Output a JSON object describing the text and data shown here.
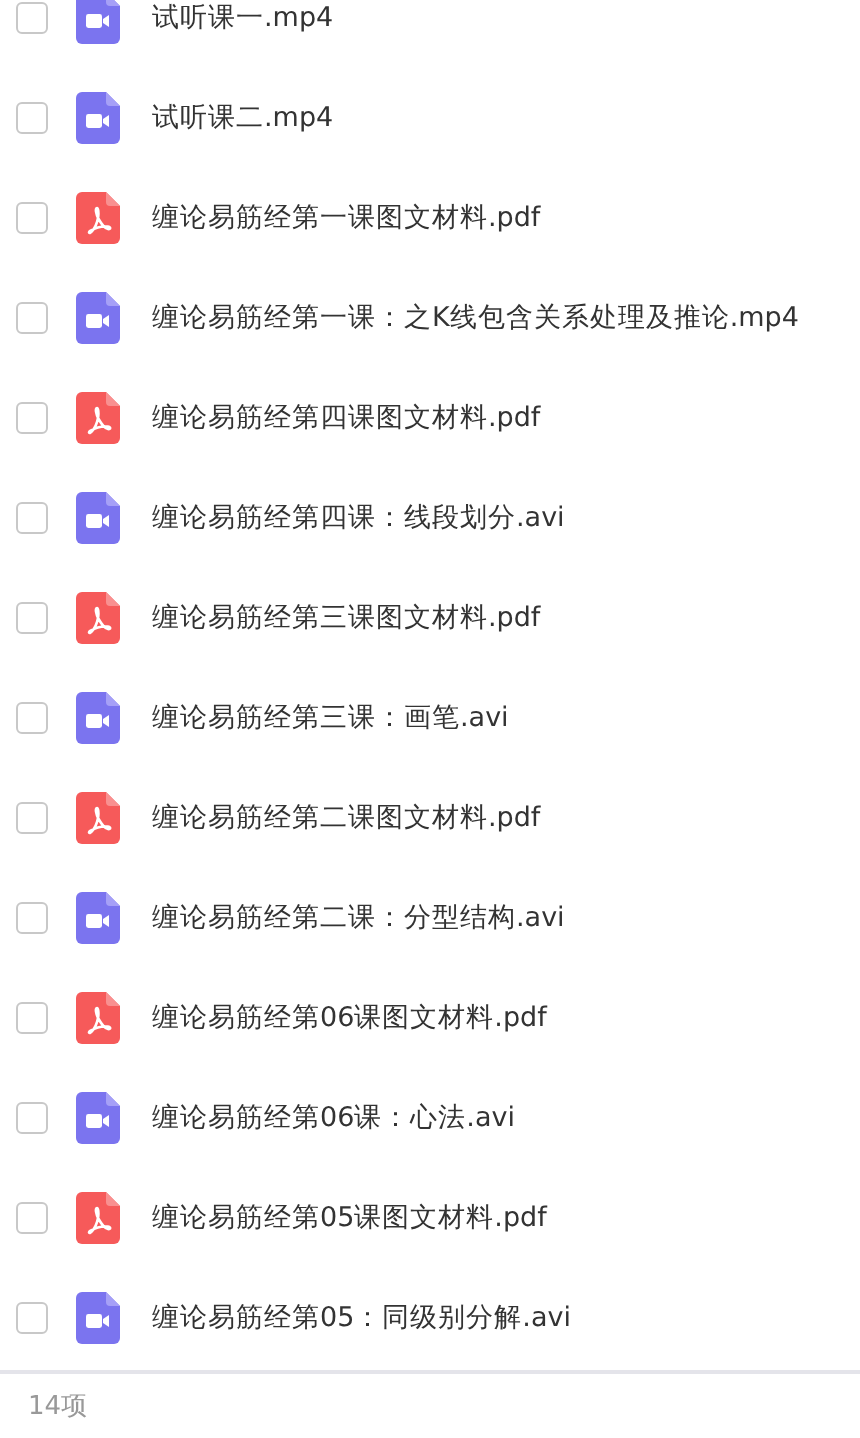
{
  "files": [
    {
      "name": "试听课一.mp4",
      "kind": "video",
      "checked": false
    },
    {
      "name": "试听课二.mp4",
      "kind": "video",
      "checked": false
    },
    {
      "name": "缠论易筋经第一课图文材料.pdf",
      "kind": "pdf",
      "checked": false
    },
    {
      "name": "缠论易筋经第一课：之K线包含关系处理及推论.mp4",
      "kind": "video",
      "checked": false
    },
    {
      "name": "缠论易筋经第四课图文材料.pdf",
      "kind": "pdf",
      "checked": false
    },
    {
      "name": "缠论易筋经第四课：线段划分.avi",
      "kind": "video",
      "checked": false
    },
    {
      "name": "缠论易筋经第三课图文材料.pdf",
      "kind": "pdf",
      "checked": false
    },
    {
      "name": "缠论易筋经第三课：画笔.avi",
      "kind": "video",
      "checked": false
    },
    {
      "name": "缠论易筋经第二课图文材料.pdf",
      "kind": "pdf",
      "checked": false
    },
    {
      "name": "缠论易筋经第二课：分型结构.avi",
      "kind": "video",
      "checked": false
    },
    {
      "name": "缠论易筋经第06课图文材料.pdf",
      "kind": "pdf",
      "checked": false
    },
    {
      "name": "缠论易筋经第06课：心法.avi",
      "kind": "video",
      "checked": false
    },
    {
      "name": "缠论易筋经第05课图文材料.pdf",
      "kind": "pdf",
      "checked": false
    },
    {
      "name": "缠论易筋经第05：同级别分解.avi",
      "kind": "video",
      "checked": false
    }
  ],
  "footer": {
    "count": "14项"
  }
}
